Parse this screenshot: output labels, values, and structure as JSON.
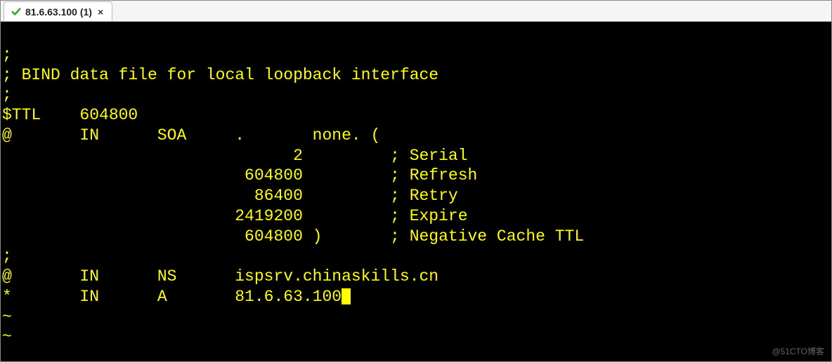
{
  "tab": {
    "title": "81.6.63.100 (1)",
    "close_glyph": "×"
  },
  "terminal": {
    "lines": [
      ";",
      "; BIND data file for local loopback interface",
      ";",
      "$TTL    604800",
      "@       IN      SOA     .       none. (",
      "                              2         ; Serial",
      "                         604800         ; Refresh",
      "                          86400         ; Retry",
      "                        2419200         ; Expire",
      "                         604800 )       ; Negative Cache TTL",
      ";",
      "@       IN      NS      ispsrv.chinaskills.cn",
      "*       IN      A       81.6.63.100"
    ],
    "tilde_lines": [
      "~",
      "~"
    ]
  },
  "watermark": "@51CTO博客"
}
